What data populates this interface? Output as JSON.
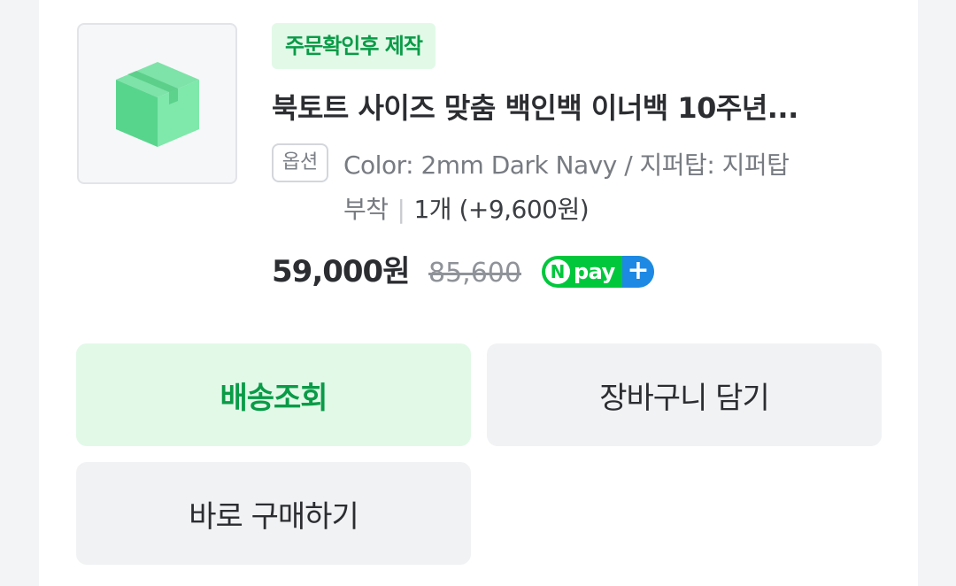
{
  "product": {
    "badge": "주문확인후 제작",
    "title": "북토트 사이즈 맞춤 백인백 이너백 10주년...",
    "option_tag": "옵션",
    "option_line1": "Color: 2mm Dark Navy / 지퍼탑: 지퍼탑",
    "option_line2": "부착",
    "option_separator": "|",
    "quantity": "1개 (+9,600원)",
    "price": "59,000원",
    "original_price": "85,600",
    "npay": {
      "n": "N",
      "pay": "pay",
      "plus": "+"
    },
    "thumbnail_icon": "box-icon"
  },
  "actions": {
    "track_shipping": "배송조회",
    "add_to_cart": "장바구니 담기",
    "buy_now": "바로 구매하기"
  },
  "colors": {
    "accent_green": "#0a9b47",
    "badge_bg": "#e2f9e8",
    "npay_green": "#00c73c",
    "npay_blue": "#1e88e5"
  }
}
